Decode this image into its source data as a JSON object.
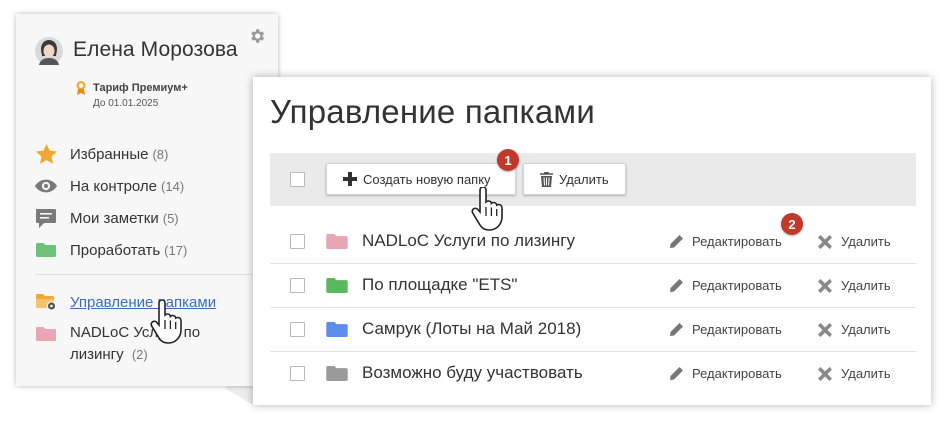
{
  "user": {
    "name": "Елена Морозова",
    "tariff": "Тариф Премиум+",
    "tariff_until": "До 01.01.2025"
  },
  "sidebar": {
    "items": [
      {
        "label": "Избранные",
        "count": "(8)",
        "icon": "star-icon"
      },
      {
        "label": "На контроле",
        "count": "(14)",
        "icon": "eye-icon"
      },
      {
        "label": "Мои заметки",
        "count": "(5)",
        "icon": "notes-icon"
      },
      {
        "label": "Проработать",
        "count": "(17)",
        "icon": "folder-icon"
      }
    ],
    "manage_link": "Управление папками",
    "folder_item": {
      "label_line1": "NADLoC Услуги по",
      "label_line2": "лизингу",
      "count": "(2)"
    }
  },
  "panel": {
    "title": "Управление папками",
    "toolbar": {
      "create_label": "Создать новую папку",
      "delete_label": "Удалить"
    },
    "folders": [
      {
        "name": "NADLoC Услуги по лизингу",
        "color": "#e8a5b2"
      },
      {
        "name": "По площадке \"ETS\"",
        "color": "#5cb85c"
      },
      {
        "name": "Самрук (Лоты на Май 2018)",
        "color": "#5b8dee"
      },
      {
        "name": "Возможно буду участвовать",
        "color": "#9a9a9a"
      }
    ],
    "edit_label": "Редактировать",
    "delete_label": "Удалить"
  },
  "badges": {
    "one": "1",
    "two": "2"
  },
  "colors": {
    "badge": "#c0392b",
    "link": "#3b6bbf",
    "star": "#f0a830"
  }
}
